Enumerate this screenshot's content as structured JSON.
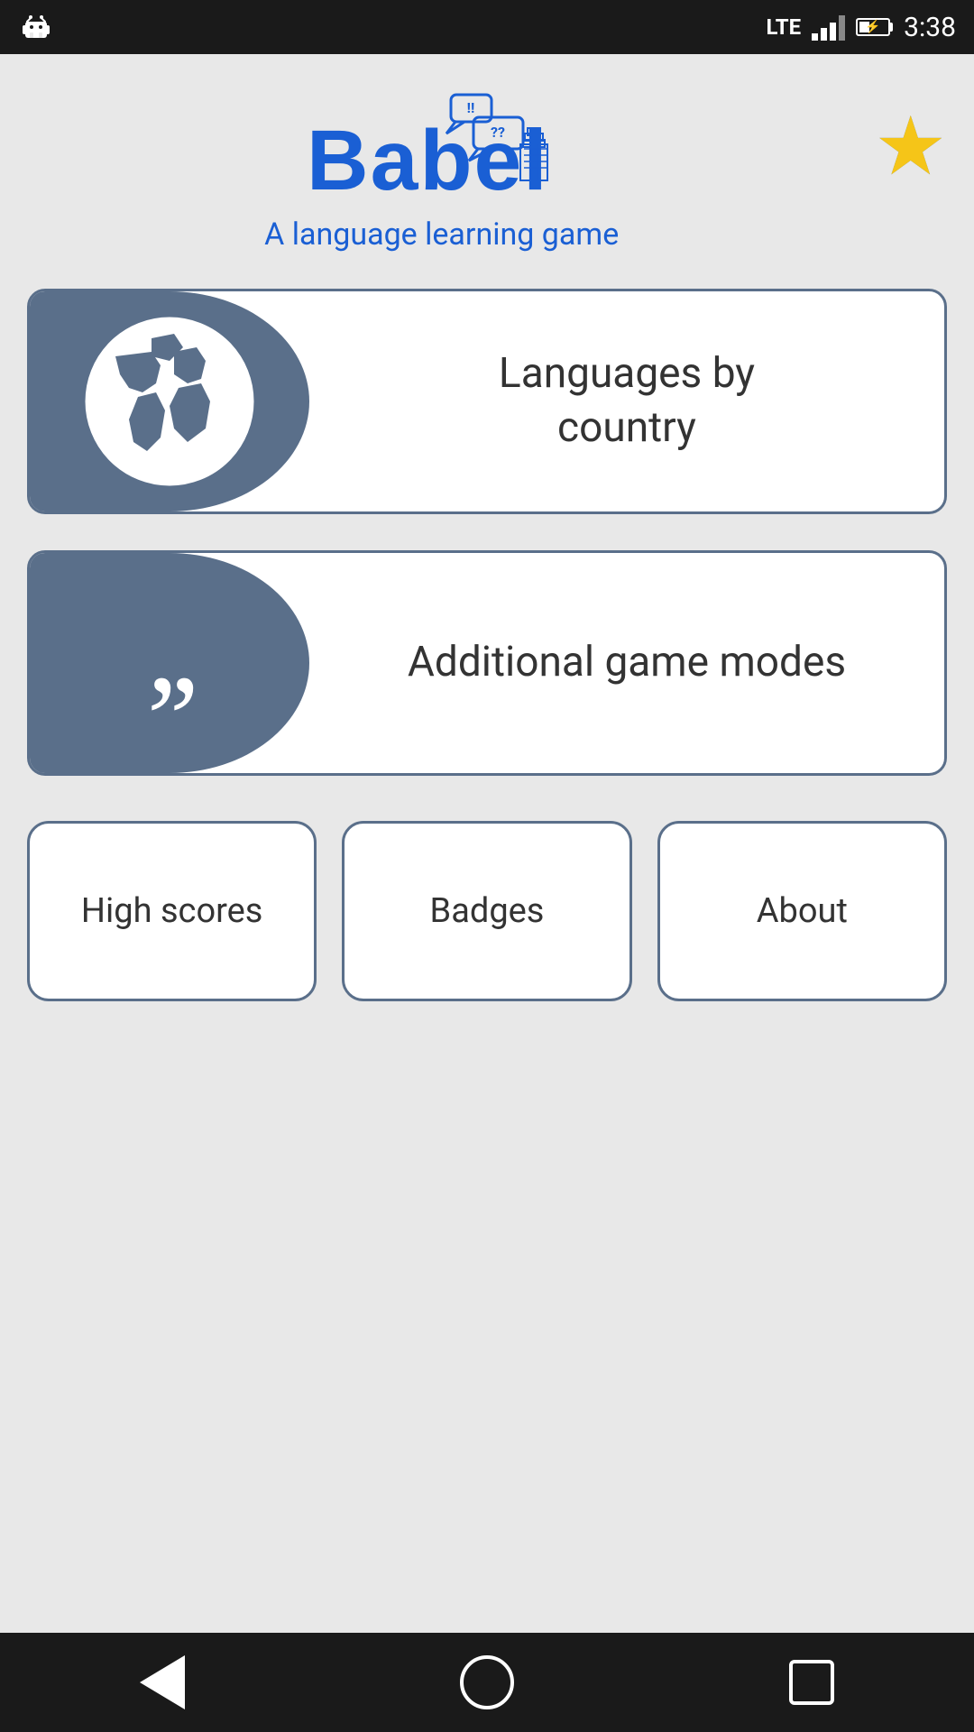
{
  "statusBar": {
    "time": "3:38",
    "lte": "LTE",
    "androidIcon": "android-icon"
  },
  "header": {
    "appName": "Babel",
    "subtitle": "A language learning game",
    "starIcon": "★"
  },
  "mainButtons": [
    {
      "id": "languages-by-country",
      "label": "Languages by\ncountry",
      "icon": "globe-icon"
    },
    {
      "id": "additional-game-modes",
      "label": "Additional game modes",
      "icon": "quote-icon"
    }
  ],
  "bottomButtons": [
    {
      "id": "high-scores",
      "label": "High scores"
    },
    {
      "id": "badges",
      "label": "Badges"
    },
    {
      "id": "about",
      "label": "About"
    }
  ],
  "colors": {
    "accent": "#5a6f8a",
    "blue": "#1a5fd4",
    "star": "#f5c518",
    "background": "#e8e8e8"
  }
}
